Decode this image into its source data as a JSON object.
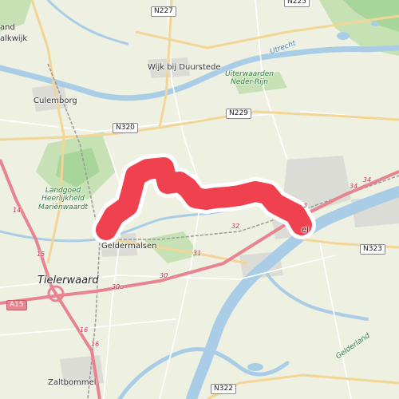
{
  "places": {
    "wijk_bij_duurstede": "Wijk bij Duurstede",
    "culemborg": "Culemborg",
    "geldermalsen": "Geldermalsen",
    "tielerwaard": "Tielerwaard",
    "zaltbommel": "Zaltbommel",
    "tiel_partial": "el",
    "landgoed": "Landgoed\nHeerlijkheid\nMariënwaardt",
    "uiterwaarden": "Uiterwaarden\nNeder-Rijn",
    "utrecht_canal": "Utrecht",
    "gelderland": "Gelderland",
    "top_left_1": "and",
    "top_left_2": "alkwijk"
  },
  "road_shields": {
    "n227": "N227",
    "n229": "N229",
    "n320": "N320",
    "n323": "N323",
    "n322": "N322",
    "a15": "A15",
    "n225_partial": "N225"
  },
  "route_numbers": {
    "r14": "14",
    "r15": "15",
    "r16a": "16",
    "r16b": "16",
    "r30": "30",
    "r31": "31",
    "r32": "32",
    "r33": "3",
    "r34": "34",
    "r34b": "34",
    "r30o": "30o"
  },
  "colors": {
    "land": "#eef0e2",
    "water": "#a9cde6",
    "forest": "#b7dba6",
    "motorway": "#e8848f",
    "primary": "#f3d596",
    "route_highlight": "#f0414f"
  }
}
